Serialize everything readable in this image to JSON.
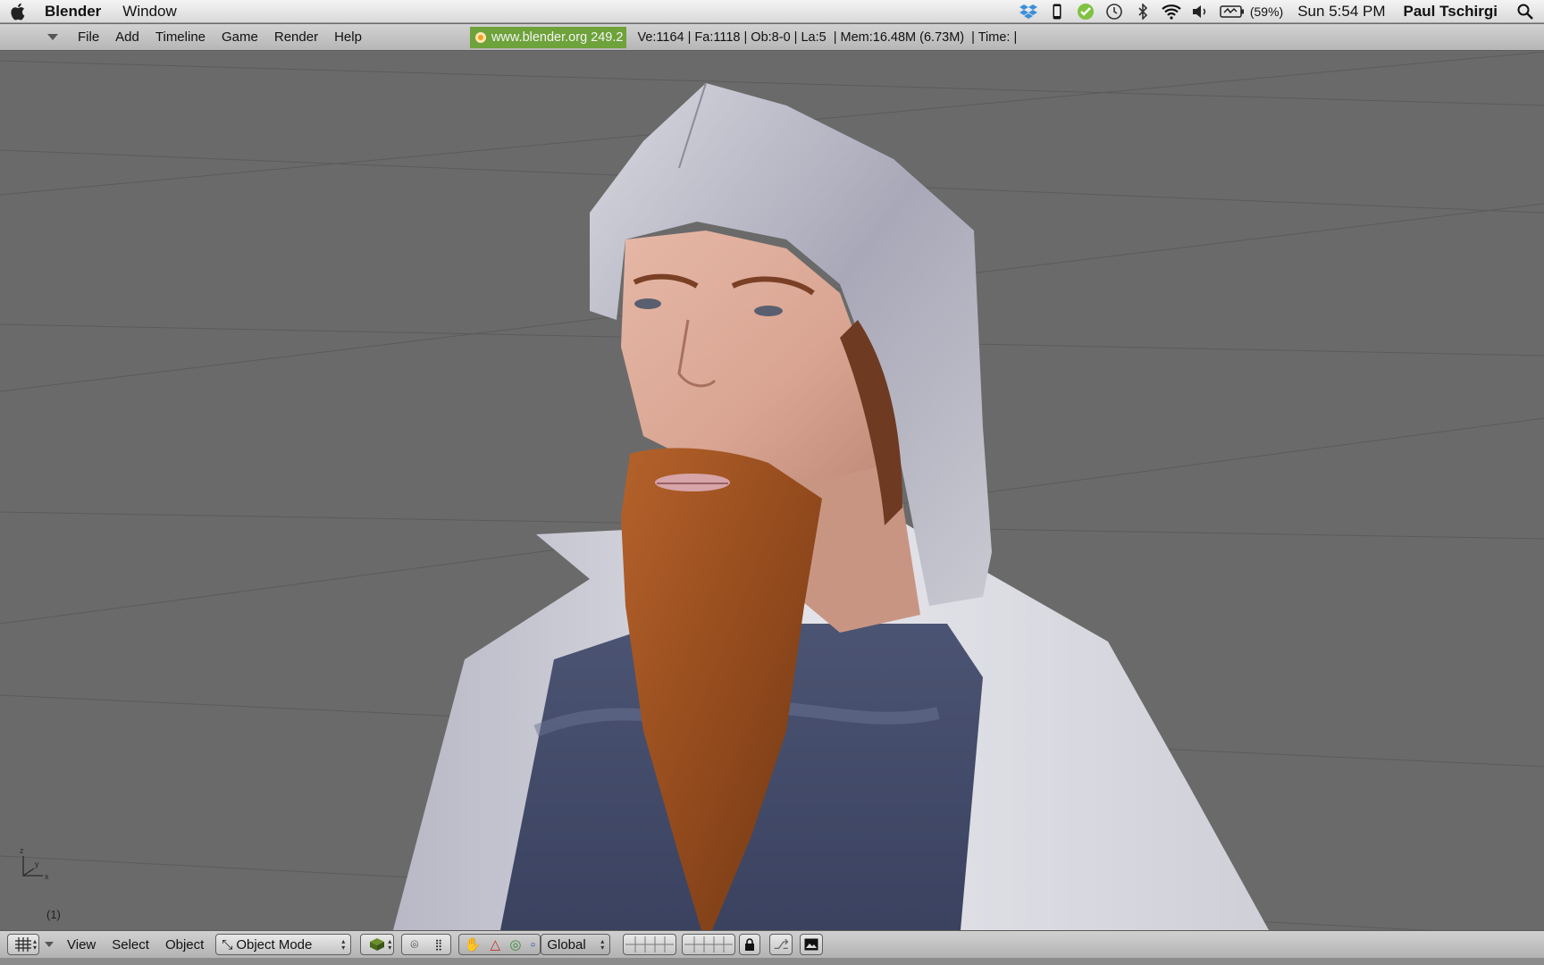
{
  "mac_menubar": {
    "app_name": "Blender",
    "menus": [
      "Window"
    ],
    "battery_percent": "(59%)",
    "clock": "Sun 5:54 PM",
    "user": "Paul Tschirgi",
    "icons": [
      "apple-icon",
      "dropbox-icon",
      "phone-icon",
      "check-shield-icon",
      "time-machine-icon",
      "bluetooth-icon",
      "wifi-icon",
      "volume-icon",
      "battery-icon",
      "spotlight-icon"
    ]
  },
  "blender_header": {
    "menus": [
      "File",
      "Add",
      "Timeline",
      "Game",
      "Render",
      "Help"
    ],
    "version_label": "www.blender.org 249.2",
    "stats": "Ve:1164 | Fa:1118 | Ob:8-0 | La:5  | Mem:16.48M (6.73M)  | Time: |"
  },
  "viewport": {
    "frame_number": "(1)",
    "axis_labels": [
      "z",
      "y",
      "x"
    ],
    "background_color": "#6a6a6a"
  },
  "footer": {
    "menus": [
      "View",
      "Select",
      "Object"
    ],
    "mode": "Object Mode",
    "transform_orientation": "Global"
  }
}
